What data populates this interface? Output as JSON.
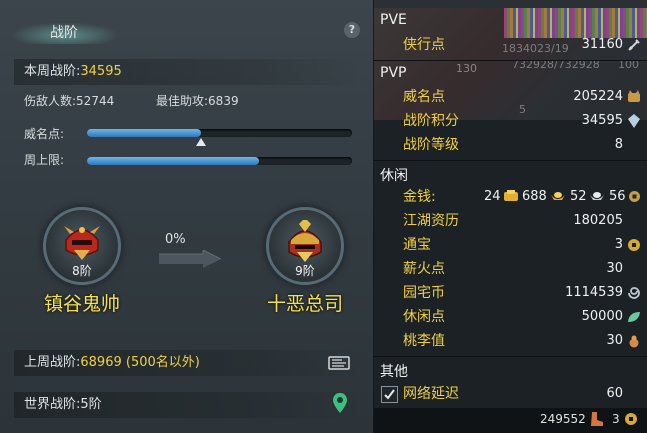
{
  "left": {
    "title": "战阶",
    "help": "?",
    "weekly_label": "本周战阶:",
    "weekly_value": "34595",
    "hurt_label": "伤敌人数:",
    "hurt_value": "52744",
    "assist_label": "最佳助攻:",
    "assist_value": "6839",
    "prestige_label": "威名点:",
    "prestige_progress": 0.43,
    "weekcap_label": "周上限:",
    "weekcap_progress": 0.65,
    "current_tier": "8阶",
    "current_rank": "镇谷鬼帅",
    "next_tier": "9阶",
    "next_rank": "十恶总司",
    "progress_pct": "0%",
    "last_week_label": "上周战阶:",
    "last_week_value": "68969 (500名以外)",
    "world_label": "世界战阶:",
    "world_value": "5阶"
  },
  "right": {
    "pve": {
      "header": "PVE",
      "items": [
        {
          "label": "侠行点",
          "value": "31160",
          "icon": "sword-icon"
        }
      ]
    },
    "pvp": {
      "header": "PVP",
      "items": [
        {
          "label": "威名点",
          "value": "205224",
          "icon": "cat-icon"
        },
        {
          "label": "战阶积分",
          "value": "34595",
          "icon": "crystal-icon"
        },
        {
          "label": "战阶等级",
          "value": "8",
          "icon": ""
        }
      ]
    },
    "leisure": {
      "header": "休闲",
      "money_label": "金钱:",
      "money_gold": "24",
      "money_silver": "688",
      "money_copper": "52",
      "money_coin": "56",
      "items": [
        {
          "label": "江湖资历",
          "value": "180205",
          "icon": ""
        },
        {
          "label": "通宝",
          "value": "3",
          "icon": "coin-icon"
        },
        {
          "label": "薪火点",
          "value": "30",
          "icon": ""
        },
        {
          "label": "园宅币",
          "value": "1114539",
          "icon": "swirl-icon"
        },
        {
          "label": "休闲点",
          "value": "50000",
          "icon": "leaf-icon"
        },
        {
          "label": "桃李值",
          "value": "30",
          "icon": "gourd-icon"
        }
      ]
    },
    "other": {
      "header": "其他",
      "items": [
        {
          "label": "网络延迟",
          "value": "60",
          "checked": true
        }
      ]
    },
    "overlay": {
      "hp_text": "1834023/19",
      "hp_text2": "732928/732928",
      "hp_pct": "100",
      "level": "130",
      "num5": "5"
    },
    "bottom": {
      "points": "249552",
      "coins": "3"
    }
  }
}
